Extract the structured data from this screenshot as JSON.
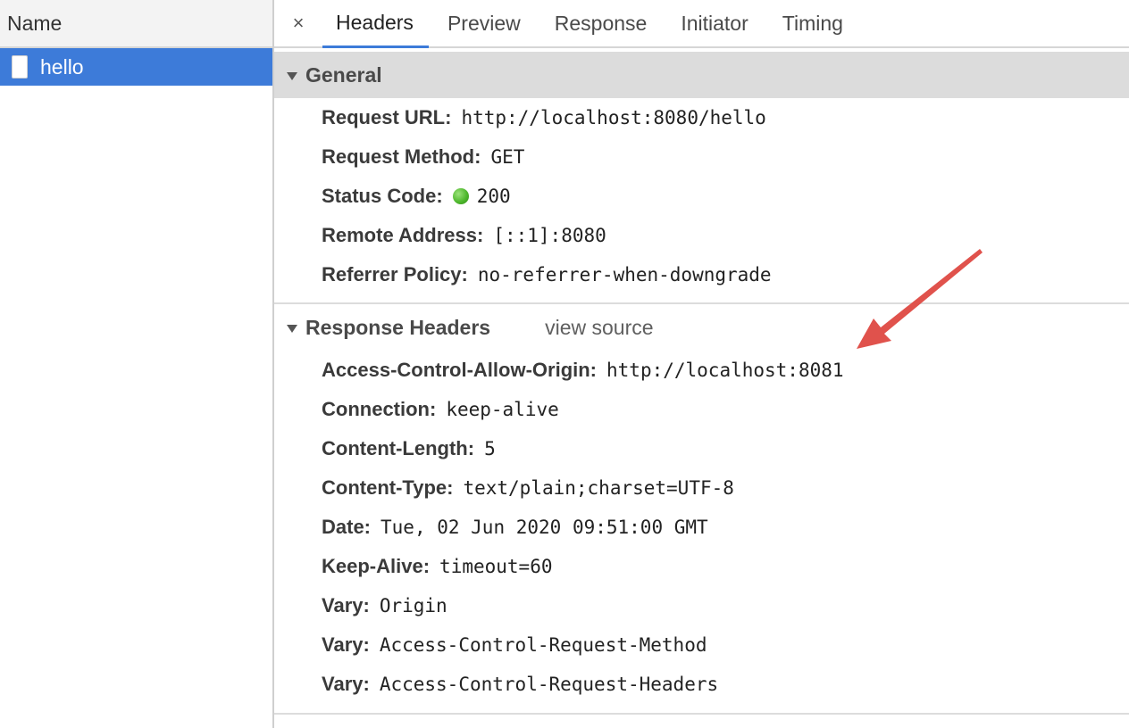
{
  "request_list": {
    "header": "Name",
    "items": [
      {
        "name": "hello",
        "icon": "document-icon",
        "selected": true
      }
    ]
  },
  "tabs": {
    "close_icon": "×",
    "items": [
      "Headers",
      "Preview",
      "Response",
      "Initiator",
      "Timing"
    ],
    "active": "Headers"
  },
  "general": {
    "title": "General",
    "rows": [
      {
        "key": "Request URL:",
        "value": "http://localhost:8080/hello"
      },
      {
        "key": "Request Method:",
        "value": "GET"
      },
      {
        "key": "Status Code:",
        "value": "200",
        "status_color": "#4fb82e"
      },
      {
        "key": "Remote Address:",
        "value": "[::1]:8080"
      },
      {
        "key": "Referrer Policy:",
        "value": "no-referrer-when-downgrade"
      }
    ]
  },
  "response_headers": {
    "title": "Response Headers",
    "view_source": "view source",
    "rows": [
      {
        "key": "Access-Control-Allow-Origin:",
        "value": "http://localhost:8081"
      },
      {
        "key": "Connection:",
        "value": "keep-alive"
      },
      {
        "key": "Content-Length:",
        "value": "5"
      },
      {
        "key": "Content-Type:",
        "value": "text/plain;charset=UTF-8"
      },
      {
        "key": "Date:",
        "value": "Tue, 02 Jun 2020 09:51:00 GMT"
      },
      {
        "key": "Keep-Alive:",
        "value": "timeout=60"
      },
      {
        "key": "Vary:",
        "value": "Origin"
      },
      {
        "key": "Vary:",
        "value": "Access-Control-Request-Method"
      },
      {
        "key": "Vary:",
        "value": "Access-Control-Request-Headers"
      }
    ]
  },
  "annotation": {
    "arrow_color": "#e0524c"
  },
  "colors": {
    "selection": "#3d7bd9",
    "section_header_bg": "#dcdcdc"
  }
}
